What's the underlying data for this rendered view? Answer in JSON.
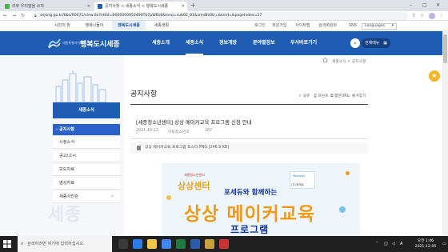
{
  "browser": {
    "tabs": [
      {
        "label": "리뷰 우리말을 쓰자"
      },
      {
        "label": "공지사항 < 세종소식 < 행복도시세종"
      }
    ],
    "new_tab": "+",
    "url": "sejong.go.kr/bbs/R0071/view.do?nttId=B000000052490Tb7pWBs8&mno=sub02_01&cmsNoStr=&kind=&pageIndex=27",
    "window_controls": [
      "–",
      "□",
      "✕"
    ]
  },
  "utilbar": {
    "sites": [
      "시민의 창",
      "행복나들이",
      "행복도시세종",
      "세종생활"
    ],
    "links": [
      "로그인",
      "회원가입",
      "사이트맵",
      "검색회원회"
    ],
    "sns": "SNS",
    "languages": "Languages"
  },
  "header": {
    "logo_small": "세종특별자치시",
    "logo": "행복도시세종",
    "menu": [
      "세종소개",
      "세종소식",
      "정보개방",
      "분야별정보",
      "부서바로가기"
    ],
    "all_menu": "전체메뉴"
  },
  "sidebar": {
    "heading": "세종소식",
    "items": [
      {
        "label": "공지사항"
      },
      {
        "label": "시정소식"
      },
      {
        "label": "공고/고시"
      },
      {
        "label": "보도자료"
      },
      {
        "label": "영상자료"
      },
      {
        "label": "세종사진관"
      }
    ],
    "watermark": "세종"
  },
  "content": {
    "breadcrumb": "세종소식 > 공지사항",
    "page_title": "공지사항",
    "tools": [
      "공유",
      "프린트",
      "짧은URL",
      "즐겨찾기"
    ],
    "post_title": "[세종청소년센터] 상상 메이커교육 프로그램 신청 안내",
    "date": "2021-10-22",
    "department": "아동청소년과",
    "views": "287",
    "attachment": "상상 메이커교육 프로그램 포스터.PNG [246.9 KB]"
  },
  "poster": {
    "brand_small": "세종청소년센터",
    "brand": "상상센터",
    "partner1": "Ponsedu",
    "partner2": "(주)포세듀",
    "subtitle": "포세듀와 함께하는",
    "title": "상상 메이커교육",
    "title2": "프로그램"
  },
  "taskbar": {
    "search_placeholder": "검색하려면 여기에 입력하십시오.",
    "tray_lang": "A",
    "time": "오전 1:46",
    "date": "2021-12-05"
  },
  "colors": {
    "primary": "#1f5db5",
    "primary_dark": "#143f80",
    "poster_orange": "#f09a1a",
    "poster_navy": "#10349c",
    "taskbar": "#202020"
  }
}
